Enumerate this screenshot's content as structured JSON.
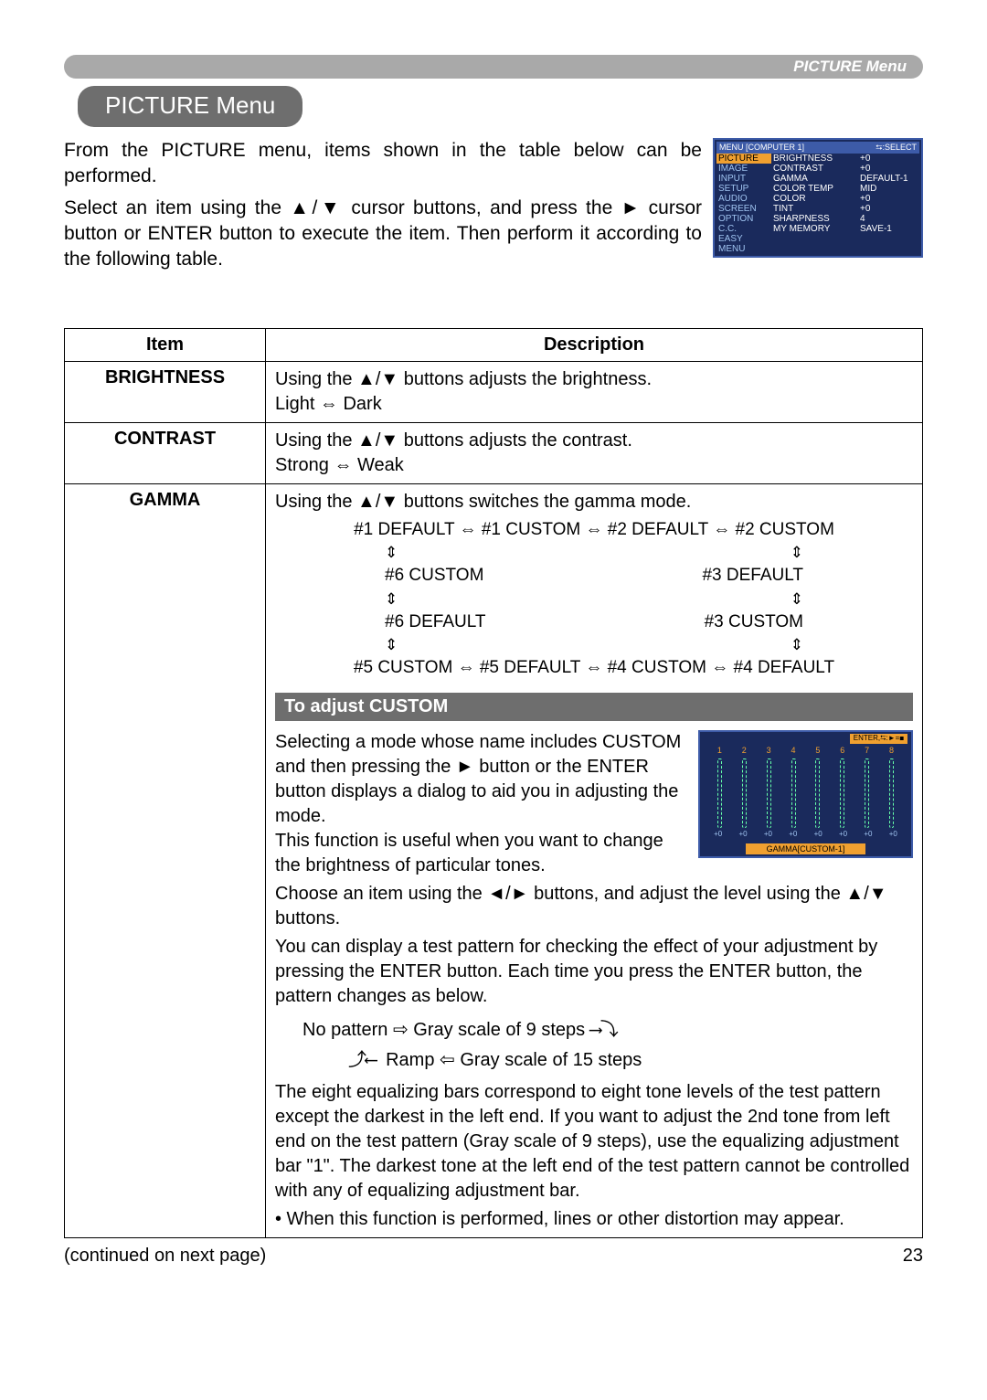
{
  "header": {
    "bar_label": "PICTURE Menu",
    "title": "PICTURE Menu"
  },
  "intro": {
    "p1": "From the PICTURE menu, items shown in the table below can be performed.",
    "p2": "Select an item using the ▲/▼ cursor buttons, and press the ► cursor button or ENTER button to execute the item. Then perform it according to the following table."
  },
  "osd": {
    "menu_label": "MENU [COMPUTER 1]",
    "select_label": "⮀:SELECT",
    "left": [
      "PICTURE",
      "IMAGE",
      "INPUT",
      "SETUP",
      "AUDIO",
      "SCREEN",
      "OPTION",
      "C.C.",
      "EASY MENU"
    ],
    "mid": [
      "BRIGHTNESS",
      "CONTRAST",
      "GAMMA",
      "COLOR TEMP",
      "COLOR",
      "TINT",
      "SHARPNESS",
      "MY MEMORY"
    ],
    "right": [
      "+0",
      "+0",
      "DEFAULT-1",
      "MID",
      "+0",
      "+0",
      "4",
      "SAVE-1"
    ]
  },
  "table": {
    "head_item": "Item",
    "head_desc": "Description",
    "rows": {
      "brightness": {
        "name": "BRIGHTNESS",
        "line1": "Using the ▲/▼ buttons adjusts the brightness.",
        "line2": "Light ⇔ Dark"
      },
      "contrast": {
        "name": "CONTRAST",
        "line1": "Using the ▲/▼ buttons adjusts the contrast.",
        "line2": "Strong ⇔ Weak"
      },
      "gamma": {
        "name": "GAMMA",
        "line1": "Using the ▲/▼ buttons switches the gamma mode.",
        "cycle_top": "#1 DEFAULT ⇔ #1 CUSTOM ⇔ #2 DEFAULT ⇔ #2 CUSTOM",
        "cycle_l2a": "#6 CUSTOM",
        "cycle_l2b": "#3 DEFAULT",
        "cycle_l3a": "#6 DEFAULT",
        "cycle_l3b": "#3 CUSTOM",
        "cycle_bot": "#5 CUSTOM ⇔ #5 DEFAULT ⇔ #4 CUSTOM ⇔ #4 DEFAULT",
        "custom_header": "To adjust CUSTOM",
        "para1": "Selecting a mode whose name includes CUSTOM and then pressing the ► button or the ENTER button displays a dialog to aid you in adjusting the mode.",
        "para2": "This function is useful when you want to change the brightness of particular tones.",
        "para3": "Choose an item using the ◄/► buttons, and adjust the level using the ▲/▼ buttons.",
        "para4": "You can display a test pattern for checking the effect of your adjustment by pressing the ENTER button. Each time you press the ENTER button, the pattern changes as below.",
        "pattern1": "No pattern ⇨ Gray scale of 9 steps",
        "pattern2": "Ramp ⇦ Gray scale of 15 steps",
        "para5": "The eight equalizing bars correspond to eight tone levels of the test pattern except the darkest in the left end. If you want to adjust the 2nd tone from left end on the test pattern (Gray scale of 9 steps), use the equalizing adjustment bar \"1\". The darkest tone at the left end of the test pattern cannot be controlled with any of equalizing adjustment bar.",
        "para6": "• When this function is performed, lines or other distortion may appear."
      }
    }
  },
  "eq": {
    "top": "ENTER,⮀:►=◼",
    "nums": [
      "1",
      "2",
      "3",
      "4",
      "5",
      "6",
      "7",
      "8"
    ],
    "vals": [
      "+0",
      "+0",
      "+0",
      "+0",
      "+0",
      "+0",
      "+0",
      "+0"
    ],
    "label": "GAMMA[CUSTOM-1]"
  },
  "footer": {
    "continued": "(continued on next page)",
    "page_num": "23"
  }
}
